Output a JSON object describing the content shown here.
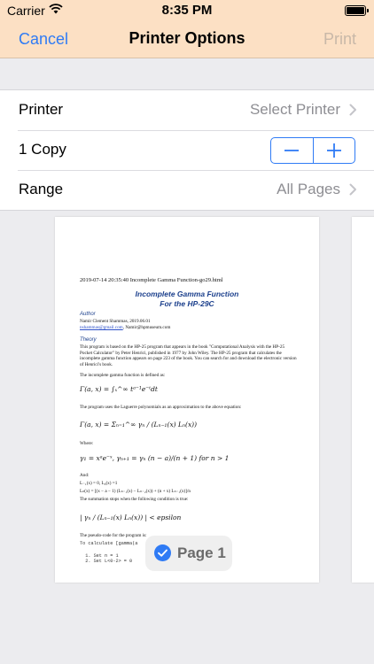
{
  "status_bar": {
    "carrier": "Carrier",
    "time": "8:35 PM"
  },
  "nav": {
    "cancel": "Cancel",
    "title": "Printer Options",
    "print": "Print"
  },
  "options": {
    "printer": {
      "label": "Printer",
      "value": "Select Printer"
    },
    "copies": {
      "label": "1 Copy",
      "decrement": "−",
      "increment": "+"
    },
    "range": {
      "label": "Range",
      "value": "All Pages"
    }
  },
  "preview": {
    "header": "2019-07-14 20:35:40 Incomplete Gamma Function-go29.html",
    "title_line1": "Incomplete Gamma Function",
    "title_line2": "For the HP-29C",
    "author_heading": "Author",
    "author_name": "Namir Clement Shammas, 2019.06.01",
    "author_email": "nshammas@gmail.com",
    "author_email_rest": ", Namir@hpmuseum.com",
    "theory_heading": "Theory",
    "theory_text": "This program is based on the HP-25 program that appears in the book \"Computational Analysis with the HP-25 Pocket Calculator\" by Peter Henrici, published in 1977 by John Wiley. The HP-25 program that calculates the incomplete gamma function appears on page 223 of the book. You can search for and download the electronic version of Henrici's book.",
    "defined_text": "The incomplete gamma function is defined as:",
    "eq1": "Γ(a, x) = ∫ₓ^∞ tᵃ⁻¹e⁻ᵗdt",
    "laguerre_text": "The program uses the Laguerre polynomials as an approximation to the above equation:",
    "eq2": "Γ(a, x) = Σₙ₌₁^∞ γₙ / (Lₙ₋₁(x) Lₙ(x))",
    "where_text": "Where:",
    "eq3": "γ₁ = xᵃe⁻ˣ, γₙ₊₁ = γₙ (n − a)/(n + 1)  for n > 1",
    "and_text": "And:",
    "l_init": "L₋₁(x) = 0, L₀(x) =1",
    "l_recur": "Lₙ(x) = [(x − a − 1) (Lₙ₋₁(x) − Lₙ₋₂(x)) + (n + x) Lₙ₋₁(x)]/n",
    "stop_text": "The summation stops when the following condition is true:",
    "eq4": "| γₙ / (Lₙ₋₁(x) Lₙ(x)) | < epsilon",
    "pseudo_text": "The pseudo-code for the program is:",
    "code_lines": "To calculate [gamma(a\n\n  1. Set n = 1\n  2. Set L<0-2> = 0"
  },
  "page_badge": {
    "label": "Page 1"
  },
  "colors": {
    "accent": "#2f7bf5",
    "nav_background": "#fce0c4",
    "disabled": "#c8b8a8"
  },
  "icons": [
    "wifi-icon",
    "battery-icon",
    "chevron-right-icon",
    "minus-icon",
    "plus-icon",
    "checkmark-circle-icon"
  ]
}
